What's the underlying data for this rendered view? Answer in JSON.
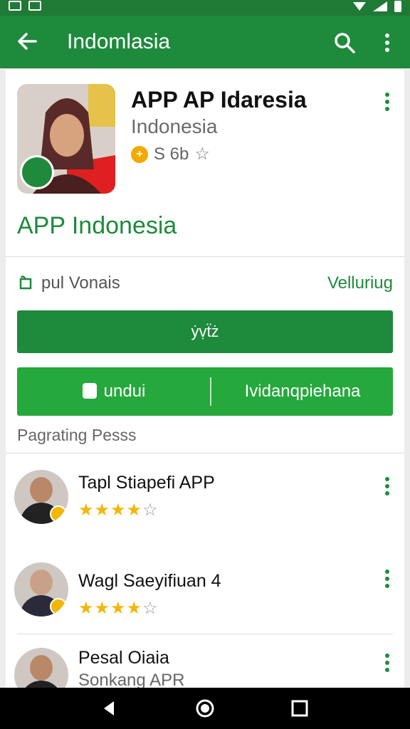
{
  "app_bar": {
    "title": "Indomlasia",
    "color": "#1e8a3c"
  },
  "app": {
    "name": "APP AP Idaresia",
    "subtitle": "Indonesia",
    "rating_text": "S 6b",
    "coin_glyph": "+"
  },
  "headline": "APP Indonesia",
  "permission": {
    "label": "pul Vonais",
    "link": "Velluriug"
  },
  "primary_button": {
    "label": "ẏṿẗż"
  },
  "split_button": {
    "left_label": "undui",
    "right_label": "Ividanqpiehana"
  },
  "section_label": "Pagrating Pesss",
  "list": [
    {
      "name": "Tapl Stiapefi APP",
      "rating": 4,
      "max": 5
    },
    {
      "name": "Wagl Saeyifiuan 4",
      "rating": 4,
      "max": 5
    },
    {
      "name": "Pesal Oiaia",
      "subtitle": "Sonkang APR"
    }
  ],
  "icons": [
    "back-arrow-icon",
    "search-icon",
    "more-vert-icon",
    "star-outline-icon",
    "coin-icon",
    "gift-icon",
    "lock-icon",
    "nav-back-icon",
    "nav-home-icon",
    "nav-recents-icon"
  ]
}
